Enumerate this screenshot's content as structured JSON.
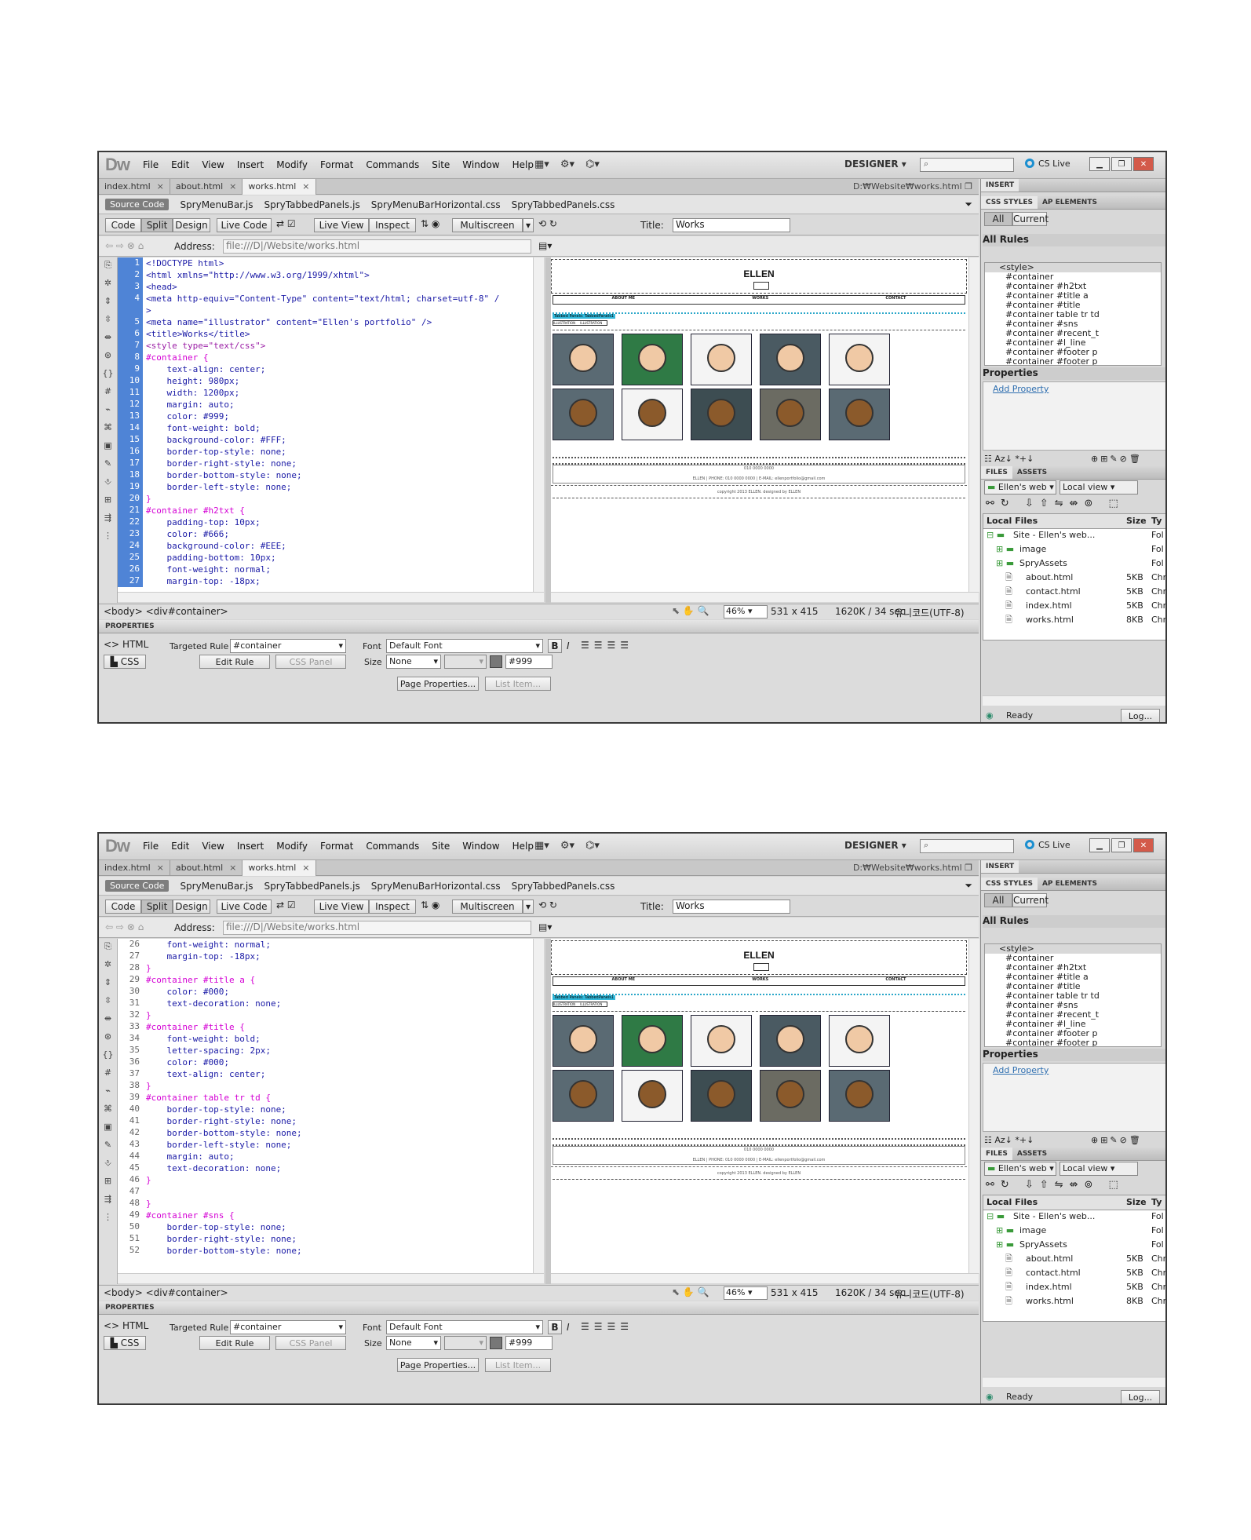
{
  "app": {
    "logo": "Dw",
    "menu": [
      "File",
      "Edit",
      "View",
      "Insert",
      "Modify",
      "Format",
      "Commands",
      "Site",
      "Window",
      "Help"
    ],
    "layout_icon": "layout-icon",
    "extend_icon": "gear-icon",
    "site_icon": "site-icon",
    "workspace": "DESIGNER",
    "search_placeholder": "",
    "cs_live": "CS Live"
  },
  "doc_tabs": [
    {
      "label": "index.html"
    },
    {
      "label": "about.html"
    },
    {
      "label": "works.html"
    }
  ],
  "doc_path": "D:₩Website₩works.html",
  "related_files": [
    "Source Code",
    "SpryMenuBar.js",
    "SpryTabbedPanels.js",
    "SpryMenuBarHorizontal.css",
    "SpryTabbedPanels.css"
  ],
  "document_toolbar": {
    "code": "Code",
    "split": "Split",
    "design": "Design",
    "live_code": "Live Code",
    "live_view": "Live View",
    "inspect": "Inspect",
    "multiscreen": "Multiscreen",
    "title_label": "Title:",
    "title_value": "Works"
  },
  "address": {
    "label": "Address:",
    "value": "file:///D|/Website/works.html"
  },
  "code_panes": [
    {
      "lines": [
        {
          "n": "1",
          "text": "<!DOCTYPE html>",
          "color": "#1a1aa6"
        },
        {
          "n": "2",
          "text": "<html xmlns=\"http://www.w3.org/1999/xhtml\">",
          "color": "#1a1aa6"
        },
        {
          "n": "3",
          "text": "<head>",
          "color": "#1a1aa6"
        },
        {
          "n": "4",
          "text": "<meta http-equiv=\"Content-Type\" content=\"text/html; charset=utf-8\" /",
          "color": "#1a1aa6"
        },
        {
          "n": "",
          "text": ">",
          "color": "#1a1aa6"
        },
        {
          "n": "5",
          "text": "<meta name=\"illustrator\" content=\"Ellen's portfolio\" />",
          "color": "#1a1aa6"
        },
        {
          "n": "6",
          "text": "<title>Works</title>",
          "color": "#1a1aa6"
        },
        {
          "n": "7",
          "text": "<style type=\"text/css\">",
          "color": "#9b1fa6"
        },
        {
          "n": "8",
          "text": "#container {",
          "color": "#d400d4"
        },
        {
          "n": "9",
          "text": "    text-align: center;",
          "color": "#1a1aa6"
        },
        {
          "n": "10",
          "text": "    height: 980px;",
          "color": "#1a1aa6"
        },
        {
          "n": "11",
          "text": "    width: 1200px;",
          "color": "#1a1aa6"
        },
        {
          "n": "12",
          "text": "    margin: auto;",
          "color": "#1a1aa6"
        },
        {
          "n": "13",
          "text": "    color: #999;",
          "color": "#1a1aa6"
        },
        {
          "n": "14",
          "text": "    font-weight: bold;",
          "color": "#1a1aa6"
        },
        {
          "n": "15",
          "text": "    background-color: #FFF;",
          "color": "#1a1aa6"
        },
        {
          "n": "16",
          "text": "    border-top-style: none;",
          "color": "#1a1aa6"
        },
        {
          "n": "17",
          "text": "    border-right-style: none;",
          "color": "#1a1aa6"
        },
        {
          "n": "18",
          "text": "    border-bottom-style: none;",
          "color": "#1a1aa6"
        },
        {
          "n": "19",
          "text": "    border-left-style: none;",
          "color": "#1a1aa6"
        },
        {
          "n": "20",
          "text": "}",
          "color": "#d400d4"
        },
        {
          "n": "21",
          "text": "#container #h2txt {",
          "color": "#d400d4"
        },
        {
          "n": "22",
          "text": "    padding-top: 10px;",
          "color": "#1a1aa6"
        },
        {
          "n": "23",
          "text": "    color: #666;",
          "color": "#1a1aa6"
        },
        {
          "n": "24",
          "text": "    background-color: #EEE;",
          "color": "#1a1aa6"
        },
        {
          "n": "25",
          "text": "    padding-bottom: 10px;",
          "color": "#1a1aa6"
        },
        {
          "n": "26",
          "text": "    font-weight: normal;",
          "color": "#1a1aa6"
        },
        {
          "n": "27",
          "text": "    margin-top: -18px;",
          "color": "#1a1aa6"
        }
      ]
    },
    {
      "lines": [
        {
          "n": "26",
          "text": "    font-weight: normal;",
          "color": "#1a1aa6"
        },
        {
          "n": "27",
          "text": "    margin-top: -18px;",
          "color": "#1a1aa6"
        },
        {
          "n": "28",
          "text": "}",
          "color": "#d400d4"
        },
        {
          "n": "29",
          "text": "#container #title a {",
          "color": "#d400d4"
        },
        {
          "n": "30",
          "text": "    color: #000;",
          "color": "#1a1aa6"
        },
        {
          "n": "31",
          "text": "    text-decoration: none;",
          "color": "#1a1aa6"
        },
        {
          "n": "32",
          "text": "}",
          "color": "#d400d4"
        },
        {
          "n": "33",
          "text": "#container #title {",
          "color": "#d400d4"
        },
        {
          "n": "34",
          "text": "    font-weight: bold;",
          "color": "#1a1aa6"
        },
        {
          "n": "35",
          "text": "    letter-spacing: 2px;",
          "color": "#1a1aa6"
        },
        {
          "n": "36",
          "text": "    color: #000;",
          "color": "#1a1aa6"
        },
        {
          "n": "37",
          "text": "    text-align: center;",
          "color": "#1a1aa6"
        },
        {
          "n": "38",
          "text": "}",
          "color": "#d400d4"
        },
        {
          "n": "39",
          "text": "#container table tr td {",
          "color": "#d400d4"
        },
        {
          "n": "40",
          "text": "    border-top-style: none;",
          "color": "#1a1aa6"
        },
        {
          "n": "41",
          "text": "    border-right-style: none;",
          "color": "#1a1aa6"
        },
        {
          "n": "42",
          "text": "    border-bottom-style: none;",
          "color": "#1a1aa6"
        },
        {
          "n": "43",
          "text": "    border-left-style: none;",
          "color": "#1a1aa6"
        },
        {
          "n": "44",
          "text": "    margin: auto;",
          "color": "#1a1aa6"
        },
        {
          "n": "45",
          "text": "    text-decoration: none;",
          "color": "#1a1aa6"
        },
        {
          "n": "46",
          "text": "}",
          "color": "#d400d4"
        },
        {
          "n": "47",
          "text": "",
          "color": "#1a1aa6"
        },
        {
          "n": "48",
          "text": "}",
          "color": "#d400d4"
        },
        {
          "n": "49",
          "text": "#container #sns {",
          "color": "#d400d4"
        },
        {
          "n": "50",
          "text": "    border-top-style: none;",
          "color": "#1a1aa6"
        },
        {
          "n": "51",
          "text": "    border-right-style: none;",
          "color": "#1a1aa6"
        },
        {
          "n": "52",
          "text": "    border-bottom-style: none;",
          "color": "#1a1aa6"
        }
      ]
    }
  ],
  "design_view": {
    "site_title": "ELLEN",
    "nav": [
      "ABOUT ME",
      "WORKS",
      "CONTACT"
    ],
    "tabbed_label": "Tabbed Panels: TabbedPanels1",
    "tab_labels": [
      "ILLUSTRATION",
      "ILLUSTRATION"
    ],
    "footer_phone": "ELLEN | PHONE: 010 0000 0000 | E-MAIL: ellenportfolio@gmail.com",
    "footer_copy": "copyright 2013 ELLEN. designed by ELLEN",
    "footer_sns": "010 0000 0000",
    "image_colors": [
      [
        "#5a6a73",
        "#2f7a45",
        "#f4f4f4",
        "#4a5a62",
        "#f4f4f4"
      ],
      [
        "#5a6a73",
        "#f4f4f4",
        "#3d4d52",
        "#6b6b62",
        "#5a6a73"
      ]
    ]
  },
  "status": {
    "tags": "<body> <div#container>",
    "zoom": "46%",
    "size": "531 x 415",
    "download": "1620K / 34 sec",
    "encoding": "유니코드(UTF-8)"
  },
  "properties": {
    "header": "PROPERTIES",
    "html_btn": "HTML",
    "css_btn": "CSS",
    "targeted_rule_label": "Targeted Rule",
    "targeted_rule": "#container",
    "edit_rule": "Edit Rule",
    "css_panel": "CSS Panel",
    "font_label": "Font",
    "font_value": "Default Font",
    "size_label": "Size",
    "size_value": "None",
    "color_value": "#999",
    "page_properties": "Page Properties...",
    "list_item": "List Item..."
  },
  "right_panel": {
    "insert": "INSERT",
    "css_styles": "CSS STYLES",
    "ap_elements": "AP ELEMENTS",
    "all": "All",
    "current": "Current",
    "all_rules": "All Rules",
    "rules": [
      "<style>",
      "#container",
      "#container #h2txt",
      "#container #title a",
      "#container #title",
      "#container table tr td",
      "#container #sns",
      "#container #recent_t",
      "#container #l_line",
      "#container #footer p",
      "#container #footer p"
    ],
    "properties": "Properties",
    "add_property": "Add Property",
    "files_tab": "FILES",
    "assets_tab": "ASSETS",
    "site_select": "Ellen's web",
    "view_select": "Local view",
    "local_files": "Local Files",
    "size_col": "Size",
    "type_col": "Ty",
    "files": [
      {
        "name": "Site - Ellen's web...",
        "size": "",
        "type": "Fol",
        "indent": 0
      },
      {
        "name": "image",
        "size": "",
        "type": "Fol",
        "indent": 1
      },
      {
        "name": "SpryAssets",
        "size": "",
        "type": "Fol",
        "indent": 1
      },
      {
        "name": "about.html",
        "size": "5KB",
        "type": "Chr",
        "indent": 2
      },
      {
        "name": "contact.html",
        "size": "5KB",
        "type": "Chr",
        "indent": 2
      },
      {
        "name": "index.html",
        "size": "5KB",
        "type": "Chr",
        "indent": 2
      },
      {
        "name": "works.html",
        "size": "8KB",
        "type": "Chr",
        "indent": 2
      }
    ],
    "ready": "Ready",
    "log": "Log..."
  }
}
